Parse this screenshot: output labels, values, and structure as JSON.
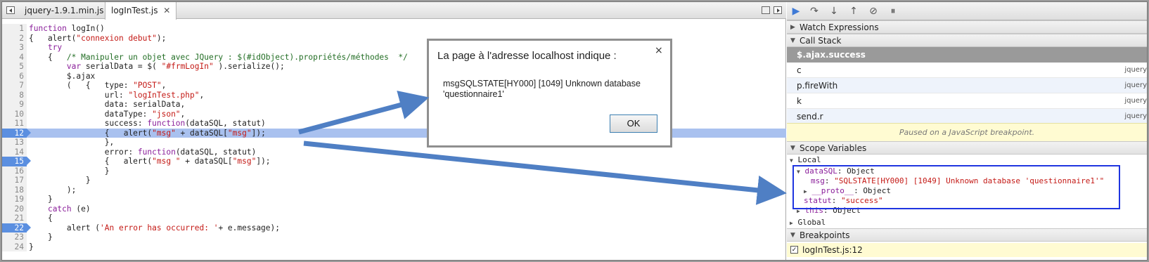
{
  "editor": {
    "tabs": [
      {
        "label": "jquery-1.9.1.min.js"
      },
      {
        "label": "logInTest.js",
        "close": "✕"
      }
    ],
    "lines": [
      {
        "n": "1",
        "html": "<span class='kw'>function</span> logIn()"
      },
      {
        "n": "2",
        "html": "{   alert(<span class='str'>\"connexion debut\"</span>);"
      },
      {
        "n": "3",
        "html": "    <span class='kw'>try</span>"
      },
      {
        "n": "4",
        "html": "    {   <span class='cm'>/* Manipuler un objet avec JQuery : $(#idObject).propriétés/méthodes  */</span>"
      },
      {
        "n": "5",
        "html": "        <span class='kw'>var</span> serialData = $( <span class='str'>\"#frmLogIn\"</span> ).serialize();"
      },
      {
        "n": "6",
        "html": "        $.ajax"
      },
      {
        "n": "7",
        "html": "        (   {   type: <span class='str'>\"POST\"</span>,"
      },
      {
        "n": "8",
        "html": "                url: <span class='str'>\"logInTest.php\"</span>,"
      },
      {
        "n": "9",
        "html": "                data: serialData,"
      },
      {
        "n": "10",
        "html": "                dataType: <span class='str'>\"json\"</span>,"
      },
      {
        "n": "11",
        "html": "                success: <span class='kw'>function</span>(dataSQL, statut)"
      },
      {
        "n": "12",
        "html": "                {   alert(<span class='str'>\"msg\"</span> + dataSQL[<span class='str'>\"msg\"</span>]);",
        "bp": true,
        "hl": true
      },
      {
        "n": "13",
        "html": "                },"
      },
      {
        "n": "14",
        "html": "                error: <span class='kw'>function</span>(dataSQL, statut)"
      },
      {
        "n": "15",
        "html": "                {   alert(<span class='str'>\"msg \"</span> + dataSQL[<span class='str'>\"msg\"</span>]);",
        "bp": true
      },
      {
        "n": "16",
        "html": "                }"
      },
      {
        "n": "17",
        "html": "            }"
      },
      {
        "n": "18",
        "html": "        );"
      },
      {
        "n": "19",
        "html": "    }"
      },
      {
        "n": "20",
        "html": "    <span class='kw'>catch</span> (e)"
      },
      {
        "n": "21",
        "html": "    {"
      },
      {
        "n": "22",
        "html": "        alert (<span class='str'>'An error has occurred: '</span>+ e.message);",
        "bp": true
      },
      {
        "n": "23",
        "html": "    }"
      },
      {
        "n": "24",
        "html": "}"
      }
    ]
  },
  "dialog": {
    "title": "La page à l'adresse localhost indique :",
    "close": "×",
    "message": "msgSQLSTATE[HY000] [1049] Unknown database 'questionnaire1'",
    "ok_label": "OK"
  },
  "debugger": {
    "sections": {
      "watch": "Watch Expressions",
      "callstack": "Call Stack",
      "scope": "Scope Variables",
      "breakpoints": "Breakpoints"
    },
    "call_stack": {
      "selected": "$.ajax.success",
      "frames": [
        {
          "name": "c",
          "loc": "jquery"
        },
        {
          "name": "p.fireWith",
          "loc": "jquery"
        },
        {
          "name": "k",
          "loc": "jquery"
        },
        {
          "name": "send.r",
          "loc": "jquery"
        }
      ]
    },
    "paused_message": "Paused on a JavaScript breakpoint.",
    "scope": {
      "local": "Local",
      "datasql_name": "dataSQL",
      "datasql_type": "Object",
      "msg_name": "msg",
      "msg_value": "\"SQLSTATE[HY000] [1049] Unknown database 'questionnaire1'\"",
      "proto_name": "__proto__",
      "proto_type": "Object",
      "statut_name": "statut",
      "statut_value": "\"success\"",
      "this_name": "this",
      "this_type": "Object",
      "global": "Global"
    },
    "breakpoint": "logInTest.js:12"
  },
  "colors": {
    "highlight": "#a9c1ef",
    "gutter_bp": "#5b8fe0",
    "arrow": "#4f7fc4",
    "scope_box": "#1f35e0",
    "paused_bg": "#fffbd2"
  }
}
